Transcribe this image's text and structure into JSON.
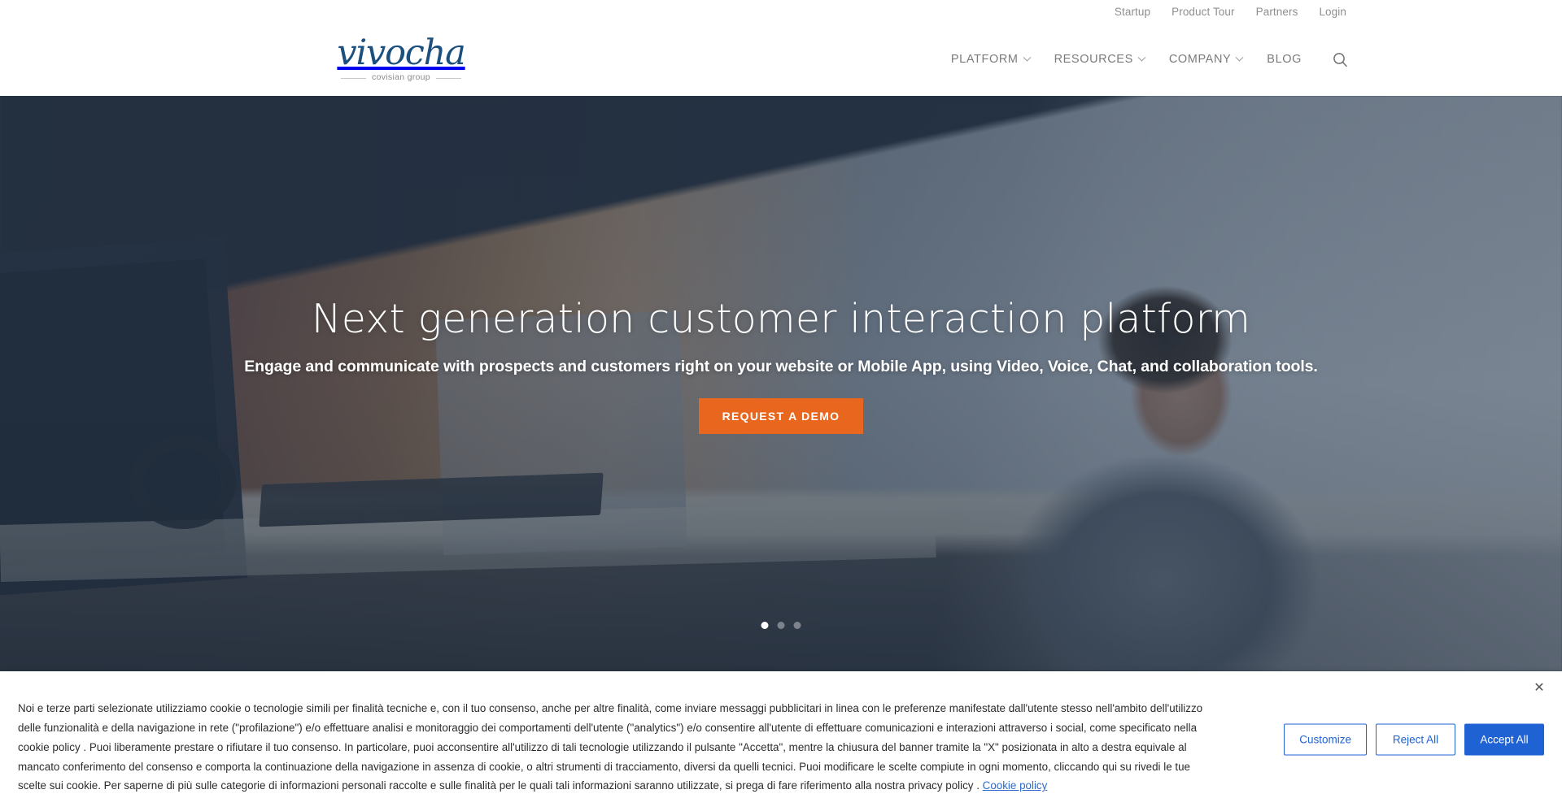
{
  "topbar": {
    "links": [
      {
        "label": "Startup"
      },
      {
        "label": "Product Tour"
      },
      {
        "label": "Partners"
      },
      {
        "label": "Login"
      }
    ]
  },
  "header": {
    "logo": {
      "wordmark": "vivocha",
      "tagline": "covisian group"
    },
    "nav": [
      {
        "label": "PLATFORM",
        "has_dropdown": true
      },
      {
        "label": "RESOURCES",
        "has_dropdown": true
      },
      {
        "label": "COMPANY",
        "has_dropdown": true
      },
      {
        "label": "BLOG",
        "has_dropdown": false
      }
    ],
    "search_icon": "search-icon"
  },
  "hero": {
    "title": "Next generation customer interaction platform",
    "subtitle": "Engage and communicate with prospects and customers right on your website or Mobile App, using Video, Voice, Chat, and collaboration tools.",
    "cta_label": "REQUEST A DEMO",
    "cta_color": "#e8661d",
    "slides": [
      {
        "active": true
      },
      {
        "active": false
      },
      {
        "active": false
      }
    ]
  },
  "cookie_banner": {
    "close_icon": "close-icon",
    "body_part1": "Noi e terze parti selezionate utilizziamo cookie o tecnologie simili per finalità tecniche e, con il tuo consenso, anche per altre finalità, come inviare messaggi pubblicitari in linea con le preferenze manifestate dall'utente stesso nell'ambito dell'utilizzo delle funzionalità e della navigazione in rete (\"profilazione\") e/o effettuare analisi e monitoraggio dei comportamenti dell'utente (\"analytics\") e/o consentire all'utente di effettuare comunicazioni e interazioni attraverso i social, come specificato nella cookie policy . Puoi liberamente prestare o rifiutare il tuo consenso. In particolare, puoi acconsentire all'utilizzo di tali tecnologie utilizzando il pulsante \"Accetta\", mentre la chiusura del banner tramite la \"X\" posizionata in alto a destra equivale al mancato conferimento del consenso e comporta la continuazione della navigazione in assenza di cookie, o altri strumenti di tracciamento, diversi da quelli tecnici. Puoi modificare le scelte compiute in ogni momento, cliccando qui su rivedi le tue scelte sui cookie. Per saperne di più sulle categorie di informazioni personali raccolte e sulle finalità per le quali tali informazioni saranno utilizzate, si prega di fare riferimento alla nostra privacy policy . ",
    "policy_link": "Cookie policy",
    "buttons": [
      {
        "label": "Customize",
        "style": "outline"
      },
      {
        "label": "Reject All",
        "style": "outline"
      },
      {
        "label": "Accept All",
        "style": "filled"
      }
    ],
    "accent_color": "#1f62d4"
  }
}
